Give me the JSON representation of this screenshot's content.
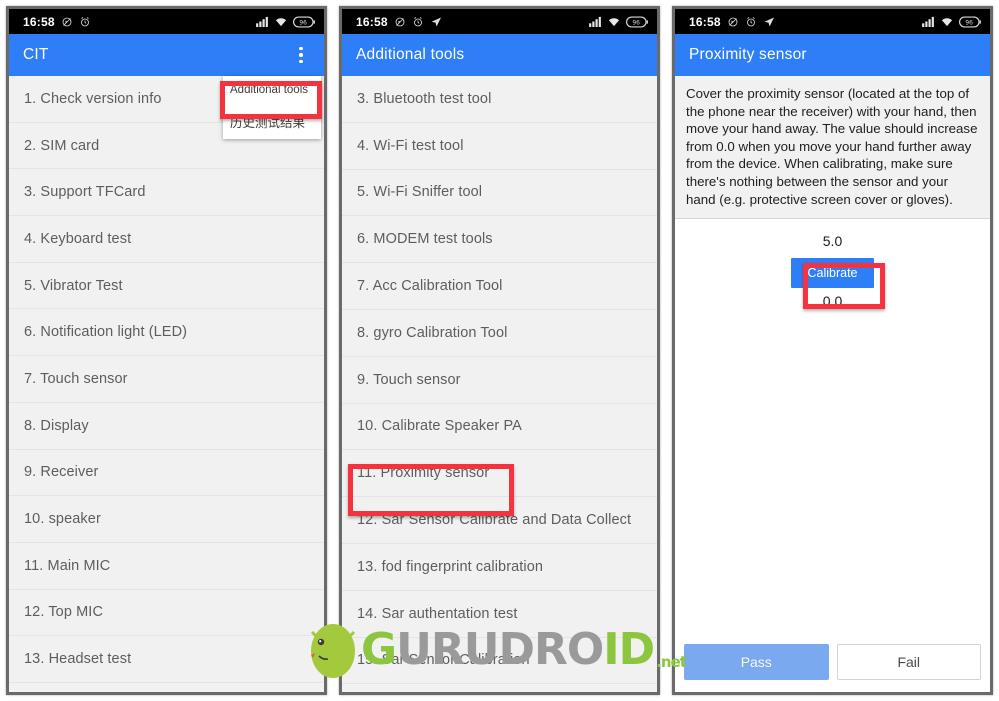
{
  "statusbar": {
    "time": "16:58",
    "icons_left": [
      "mute-icon",
      "alarm-icon",
      "location-arrow-icon"
    ],
    "icons_right": [
      "signal-icon",
      "wifi-icon",
      "battery-icon"
    ],
    "battery_label": "96"
  },
  "panel1": {
    "title": "CIT",
    "overflow_icon": "overflow-menu-icon",
    "popup": {
      "items": [
        {
          "label": "Additional tools"
        },
        {
          "label": "历史测试结果"
        }
      ]
    },
    "items": [
      {
        "label": "1. Check version info"
      },
      {
        "label": "2. SIM card"
      },
      {
        "label": "3. Support TFCard"
      },
      {
        "label": "4. Keyboard test"
      },
      {
        "label": "5. Vibrator Test"
      },
      {
        "label": "6. Notification light (LED)"
      },
      {
        "label": "7. Touch sensor"
      },
      {
        "label": "8. Display"
      },
      {
        "label": "9. Receiver"
      },
      {
        "label": "10. speaker"
      },
      {
        "label": "11. Main MIC"
      },
      {
        "label": "12. Top MIC"
      },
      {
        "label": "13. Headset test"
      }
    ]
  },
  "panel2": {
    "title": "Additional tools",
    "items": [
      {
        "label": "3. Bluetooth test tool"
      },
      {
        "label": "4. Wi-Fi test tool"
      },
      {
        "label": "5. Wi-Fi Sniffer tool"
      },
      {
        "label": "6. MODEM test tools"
      },
      {
        "label": "7. Acc Calibration Tool"
      },
      {
        "label": "8. gyro Calibration Tool"
      },
      {
        "label": "9. Touch sensor"
      },
      {
        "label": "10. Calibrate Speaker PA"
      },
      {
        "label": "11. Proximity sensor"
      },
      {
        "label": "12. Sar Sensor Calibrate and Data Collect"
      },
      {
        "label": "13. fod fingerprint calibration"
      },
      {
        "label": "14. Sar authentation test"
      },
      {
        "label": "15. Sar Sensor Calibration"
      }
    ]
  },
  "panel3": {
    "title": "Proximity sensor",
    "instructions": "Cover the proximity sensor (located at the top of the phone near the receiver) with your hand, then move your hand away. The value should increase from 0.0 when you move your hand further away from the device.\nWhen calibrating, make sure there's nothing between the sensor and your hand (e.g. protective screen cover or gloves).",
    "value_top": "5.0",
    "calibrate_label": "Calibrate",
    "value_bottom": "0.0",
    "pass_label": "Pass",
    "fail_label": "Fail"
  },
  "watermark": {
    "part_green_1": "G",
    "part_gray": "URUDRO",
    "part_green_2": "I",
    "part_green_3": "D",
    "suffix": ".net"
  },
  "colors": {
    "appbar_blue": "#2d7ef7",
    "highlight_red": "#f5333f",
    "pass_blue": "#7aa9f0",
    "watermark_green": "#8cc63f",
    "list_bg": "#f1f1f1"
  }
}
